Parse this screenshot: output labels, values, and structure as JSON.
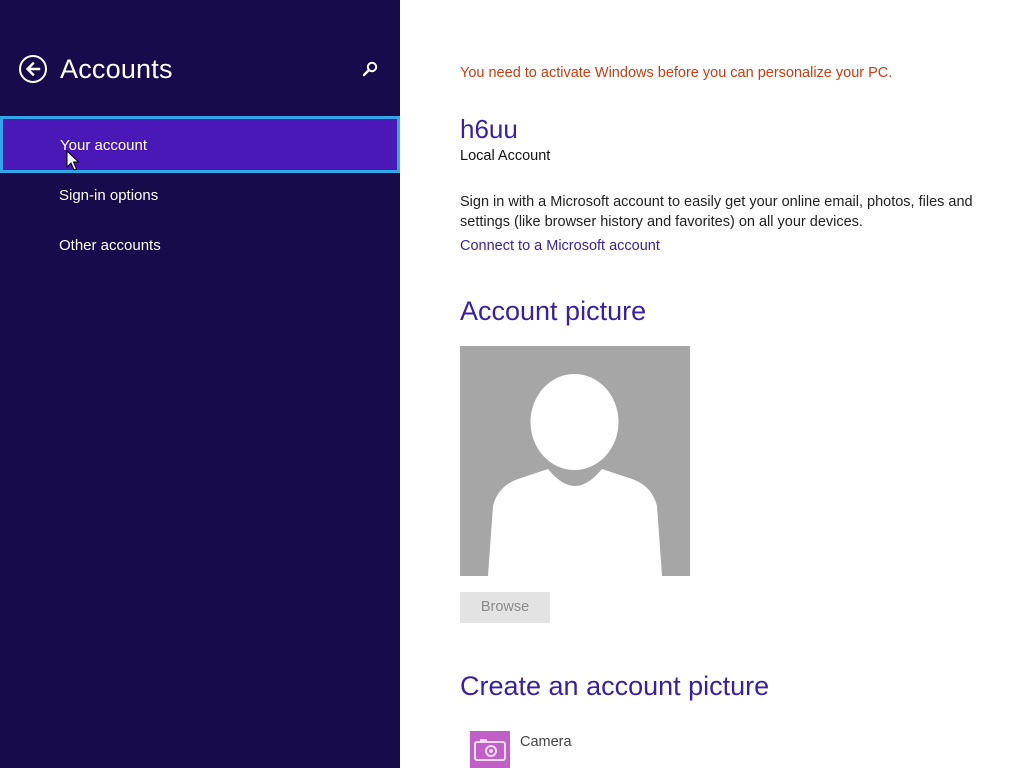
{
  "nav": {
    "title": "Accounts",
    "items": [
      {
        "label": "Your account",
        "selected": true
      },
      {
        "label": "Sign-in options",
        "selected": false
      },
      {
        "label": "Other accounts",
        "selected": false
      }
    ]
  },
  "content": {
    "warning": "You need to activate Windows before you can personalize your PC.",
    "account": {
      "name": "h6uu",
      "type": "Local Account",
      "description": "Sign in with a Microsoft account to easily get your online email, photos, files and settings (like browser history and favorites) on all your devices.",
      "connect_link": "Connect to a Microsoft account"
    },
    "account_picture": {
      "heading": "Account picture",
      "browse_label": "Browse",
      "browse_enabled": false
    },
    "create_picture": {
      "heading": "Create an account picture",
      "apps": [
        {
          "label": "Camera",
          "icon": "camera-icon"
        }
      ]
    }
  },
  "colors": {
    "nav_background": "#180a4b",
    "nav_selected": "#4a18b6",
    "nav_selected_border": "#2fa7e8",
    "accent_text": "#3b1fa3",
    "warning_text": "#d03a0e",
    "avatar_background": "#a6a6a6",
    "camera_tile": "#c05fc5"
  }
}
